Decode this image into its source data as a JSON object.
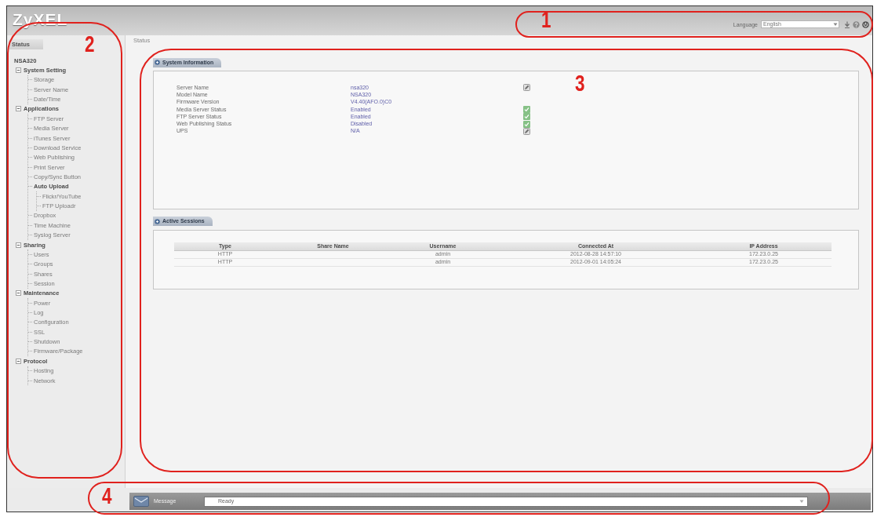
{
  "header": {
    "logo": "ZyXEL",
    "language_label": "Language",
    "language": "English"
  },
  "sidebar": {
    "tab": "Status",
    "tree": [
      {
        "label": "NSA320",
        "children": [
          {
            "label": "System Setting",
            "expanded": true,
            "children": [
              {
                "label": "Storage"
              },
              {
                "label": "Server Name"
              },
              {
                "label": "Date/Time"
              }
            ]
          },
          {
            "label": "Applications",
            "expanded": true,
            "children": [
              {
                "label": "FTP Server"
              },
              {
                "label": "Media Server"
              },
              {
                "label": "iTunes Server"
              },
              {
                "label": "Download Service"
              },
              {
                "label": "Web Publishing"
              },
              {
                "label": "Print Server"
              },
              {
                "label": "Copy/Sync Button"
              },
              {
                "label": "Auto Upload",
                "children": [
                  {
                    "label": "Flickr/YouTube"
                  },
                  {
                    "label": "FTP Uploadr"
                  }
                ]
              },
              {
                "label": "Dropbox"
              },
              {
                "label": "Time Machine"
              },
              {
                "label": "Syslog Server"
              }
            ]
          },
          {
            "label": "Sharing",
            "expanded": true,
            "children": [
              {
                "label": "Users"
              },
              {
                "label": "Groups"
              },
              {
                "label": "Shares"
              },
              {
                "label": "Session"
              }
            ]
          },
          {
            "label": "Maintenance",
            "expanded": true,
            "children": [
              {
                "label": "Power"
              },
              {
                "label": "Log"
              },
              {
                "label": "Configuration"
              },
              {
                "label": "SSL"
              },
              {
                "label": "Shutdown"
              },
              {
                "label": "Firmware/Package"
              }
            ]
          },
          {
            "label": "Protocol",
            "expanded": true,
            "children": [
              {
                "label": "Hosting"
              },
              {
                "label": "Network"
              }
            ]
          }
        ]
      }
    ]
  },
  "breadcrumb": "Status",
  "system_information": {
    "title": "System Information",
    "rows": [
      {
        "label": "Server Name",
        "value": "nsa320",
        "kind": "edit"
      },
      {
        "label": "Model Name",
        "value": "NSA320",
        "kind": "text"
      },
      {
        "label": "Firmware Version",
        "value": "V4.40(AFO.0)C0",
        "kind": "text"
      },
      {
        "label": "Media Server Status",
        "value": "Enabled",
        "kind": "service"
      },
      {
        "label": "FTP Server Status",
        "value": "Enabled",
        "kind": "service"
      },
      {
        "label": "Web Publishing Status",
        "value": "Disabled",
        "kind": "service"
      },
      {
        "label": "UPS",
        "value": "N/A",
        "kind": "edit"
      }
    ]
  },
  "active_sessions": {
    "title": "Active Sessions",
    "columns": [
      "Type",
      "Share Name",
      "Username",
      "Connected At",
      "IP Address"
    ],
    "rows": [
      [
        "HTTP",
        null,
        "admin",
        "2012-08-28 14:57:10",
        "172.23.0.25"
      ],
      [
        "HTTP",
        null,
        "admin",
        "2012-09-01 14:05:24",
        "172.23.0.25"
      ]
    ]
  },
  "status_bar": {
    "label": "Message",
    "text": "Ready"
  },
  "callouts": [
    {
      "label": "1"
    },
    {
      "label": "2"
    },
    {
      "label": "3"
    },
    {
      "label": "4"
    }
  ]
}
